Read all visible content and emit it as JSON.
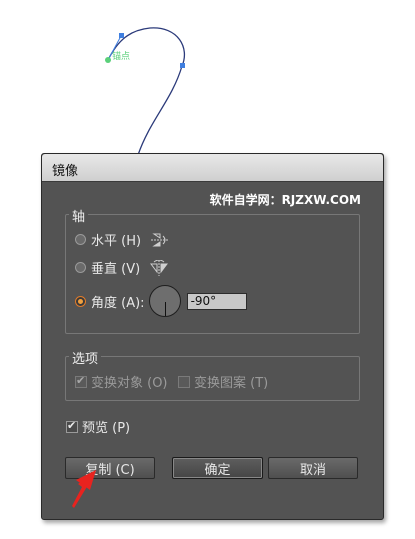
{
  "canvas": {
    "anchor_label": "锚点",
    "path_color": "#2b3a7a",
    "anchor_color": "#3f7fe0",
    "label_color": "#5ad07a"
  },
  "dialog": {
    "title": "镜像",
    "watermark": "软件自学网：RJZXW.COM",
    "axis_group": {
      "label": "轴",
      "options": [
        {
          "label": "水平 (H)",
          "checked": false,
          "icon": "horizontal-axis-icon"
        },
        {
          "label": "垂直 (V)",
          "checked": false,
          "icon": "vertical-axis-icon"
        },
        {
          "label": "角度 (A):",
          "checked": true,
          "icon": "angle-dial-icon"
        }
      ],
      "angle_value": "-90°"
    },
    "options_group": {
      "label": "选项",
      "transform_objects": {
        "label": "变换对象 (O)",
        "checked": true,
        "enabled": false
      },
      "transform_patterns": {
        "label": "变换图案 (T)",
        "checked": false,
        "enabled": false
      }
    },
    "preview": {
      "label": "预览 (P)",
      "checked": true
    },
    "buttons": {
      "copy": "复制 (C)",
      "ok": "确定",
      "cancel": "取消"
    }
  },
  "colors": {
    "dialog_bg": "#535353",
    "arrow": "#e8231f",
    "accent": "#e07b2a"
  }
}
